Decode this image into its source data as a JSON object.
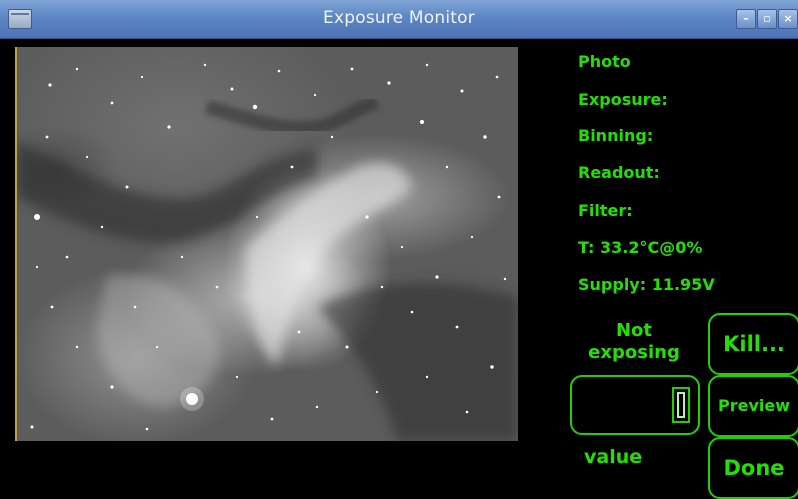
{
  "window": {
    "title": "Exposure Monitor",
    "controls": {
      "minimize": "–",
      "maximize": "▫",
      "close": "×"
    }
  },
  "info": {
    "photo": "Photo",
    "exposure": "Exposure:",
    "binning": "Binning:",
    "readout": "Readout:",
    "filter": "Filter:",
    "temperature": "T: 33.2°C@0%",
    "supply": "Supply: 11.95V"
  },
  "status": {
    "line1": "Not",
    "line2": "exposing"
  },
  "value_field": {
    "label": "value",
    "current": ""
  },
  "buttons": {
    "kill": "Kill...",
    "preview": "Preview",
    "done": "Done"
  },
  "colors": {
    "accent": "#22e000",
    "titlebar": "#5d86c4",
    "background": "#000000"
  }
}
